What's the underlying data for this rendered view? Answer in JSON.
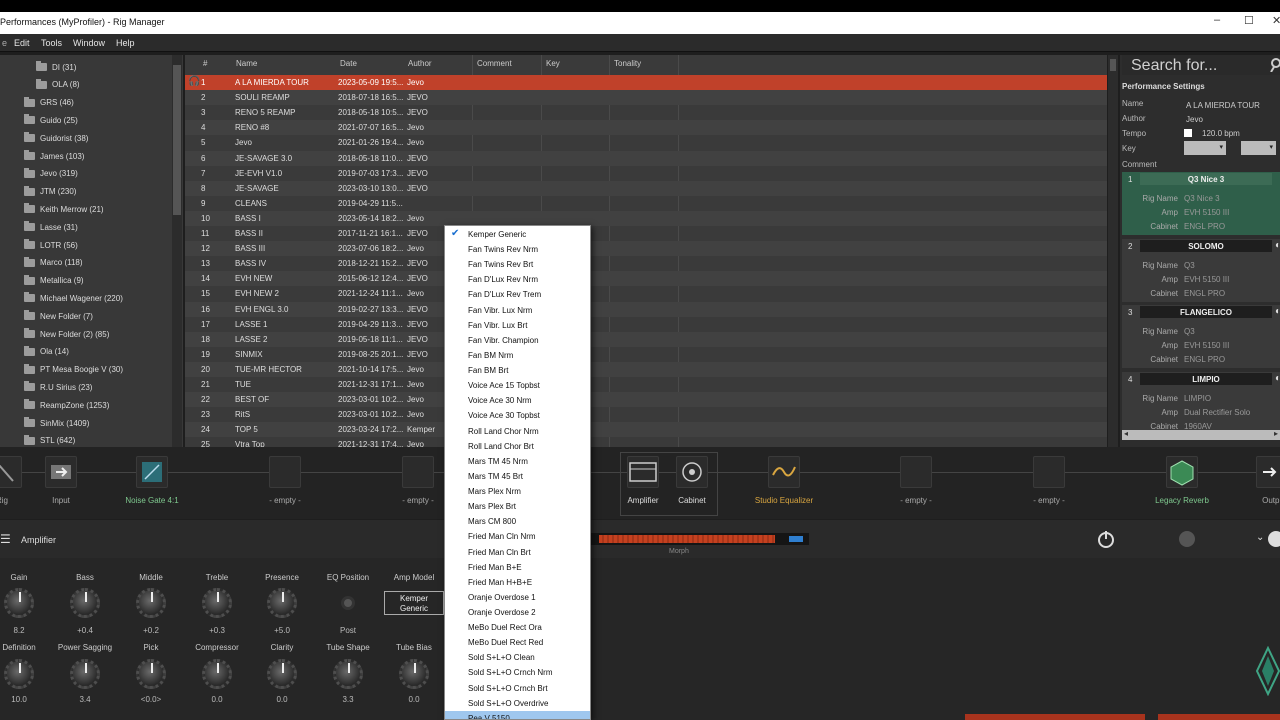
{
  "window": {
    "title": "Performances (MyProfiler) - Rig Manager",
    "minimize": "–",
    "maximize": "☐",
    "close": "✕"
  },
  "menu": [
    "Edit",
    "Tools",
    "Window",
    "Help"
  ],
  "tree": [
    "DI (31)",
    "OLA (8)",
    "GRS (46)",
    "Guido (25)",
    "Guidorist (38)",
    "James (103)",
    "Jevo (319)",
    "JTM (230)",
    "Keith Merrow (21)",
    "Lasse (31)",
    "LOTR (56)",
    "Marco (118)",
    "Metallica (9)",
    "Michael Wagener (220)",
    "New Folder (7)",
    "New Folder (2) (85)",
    "Ola (14)",
    "PT Mesa Boogie V (30)",
    "R.U Sirius (23)",
    "ReampZone (1253)",
    "SinMix (1409)",
    "STL (642)"
  ],
  "table": {
    "headers": [
      "#",
      "Name",
      "Date",
      "Author",
      "Comment",
      "Key",
      "Tonality"
    ],
    "rows": [
      [
        "1",
        "A LA MIERDA TOUR",
        "2023-05-09 19:5...",
        "Jevo"
      ],
      [
        "2",
        "SOULI REAMP",
        "2018-07-18 16:5...",
        "JEVO"
      ],
      [
        "3",
        "RENO 5 REAMP",
        "2018-05-18 10:5...",
        "JEVO"
      ],
      [
        "4",
        "RENO #8",
        "2021-07-07 16:5...",
        "Jevo"
      ],
      [
        "5",
        "Jevo",
        "2021-01-26 19:4...",
        "Jevo"
      ],
      [
        "6",
        "JE-SAVAGE 3.0",
        "2018-05-18 11:0...",
        "JEVO"
      ],
      [
        "7",
        "JE-EVH V1.0",
        "2019-07-03 17:3...",
        "JEVO"
      ],
      [
        "8",
        "JE-SAVAGE",
        "2023-03-10 13:0...",
        "JEVO"
      ],
      [
        "9",
        "CLEANS",
        "2019-04-29 11:5...",
        ""
      ],
      [
        "10",
        "BASS I",
        "2023-05-14 18:2...",
        "Jevo"
      ],
      [
        "11",
        "BASS II",
        "2017-11-21 16:1...",
        "JEVO"
      ],
      [
        "12",
        "BASS III",
        "2023-07-06 18:2...",
        "Jevo"
      ],
      [
        "13",
        "BASS IV",
        "2018-12-21 15:2...",
        "JEVO"
      ],
      [
        "14",
        "EVH NEW",
        "2015-06-12 12:4...",
        "JEVO"
      ],
      [
        "15",
        "EVH NEW 2",
        "2021-12-24 11:1...",
        "Jevo"
      ],
      [
        "16",
        "EVH ENGL 3.0",
        "2019-02-27 13:3...",
        "JEVO"
      ],
      [
        "17",
        "LASSE 1",
        "2019-04-29 11:3...",
        "JEVO"
      ],
      [
        "18",
        "LASSE 2",
        "2019-05-18 11:1...",
        "JEVO"
      ],
      [
        "19",
        "SINMIX",
        "2019-08-25 20:1...",
        "JEVO"
      ],
      [
        "20",
        "TUE-MR HECTOR",
        "2021-10-14 17:5...",
        "Jevo"
      ],
      [
        "21",
        "TUE",
        "2021-12-31 17:1...",
        "Jevo"
      ],
      [
        "22",
        "BEST OF",
        "2023-03-01 10:2...",
        "Jevo"
      ],
      [
        "23",
        "RitS",
        "2023-03-01 10:2...",
        "Jevo"
      ],
      [
        "24",
        "TOP 5",
        "2023-03-24 17:2...",
        "Kemper"
      ],
      [
        "25",
        "Vtra Top",
        "2021-12-31 17:4...",
        "Jevo"
      ]
    ]
  },
  "search": {
    "placeholder": "Search for..."
  },
  "perf_settings": {
    "title": "Performance Settings",
    "name_label": "Name",
    "name": "A LA MIERDA TOUR",
    "author_label": "Author",
    "author": "Jevo",
    "tempo_label": "Tempo",
    "tempo": "120.0 bpm",
    "key_label": "Key",
    "comment_label": "Comment"
  },
  "slots": [
    {
      "num": "1",
      "name": "Q3 Nice 3",
      "rig_name": "Q3 Nice 3",
      "amp": "EVH 5150 III",
      "cabinet": "ENGL PRO"
    },
    {
      "num": "2",
      "name": "SOLOMO",
      "rig_name": "Q3",
      "amp": "EVH 5150 III",
      "cabinet": "ENGL PRO"
    },
    {
      "num": "3",
      "name": "FLANGELICO",
      "rig_name": "Q3",
      "amp": "EVH 5150 III",
      "cabinet": "ENGL PRO"
    },
    {
      "num": "4",
      "name": "LIMPIO",
      "rig_name": "LIMPIO",
      "amp": "Dual Rectifier Solo",
      "cabinet": "1960AV"
    }
  ],
  "slot_labels": {
    "rig_name": "Rig Name",
    "amp": "Amp",
    "cabinet": "Cabinet"
  },
  "chain": {
    "rig": "Rig",
    "input": "Input",
    "noise_gate": "Noise Gate 4:1",
    "empty": "- empty -",
    "amplifier": "Amplifier",
    "cabinet": "Cabinet",
    "studio_eq": "Studio Equalizer",
    "legacy_reverb": "Legacy Reverb",
    "output": "Outpu"
  },
  "amp": {
    "title": "Amplifier",
    "morph_label": "Morph",
    "row1": [
      {
        "label": "Gain",
        "value": "8.2"
      },
      {
        "label": "Bass",
        "value": "+0.4"
      },
      {
        "label": "Middle",
        "value": "+0.2"
      },
      {
        "label": "Treble",
        "value": "+0.3"
      },
      {
        "label": "Presence",
        "value": "+5.0"
      }
    ],
    "eq_position": {
      "label": "EQ Position",
      "value": "Post"
    },
    "amp_model": {
      "label": "Amp Model",
      "value_line1": "Kemper",
      "value_line2": "Generic"
    },
    "row2": [
      {
        "label": "Definition",
        "value": "10.0"
      },
      {
        "label": "Power Sagging",
        "value": "3.4"
      },
      {
        "label": "Pick",
        "value": "<0.0>"
      },
      {
        "label": "Compressor",
        "value": "0.0"
      },
      {
        "label": "Clarity",
        "value": "0.0"
      },
      {
        "label": "Tube Shape",
        "value": "3.3"
      },
      {
        "label": "Tube Bias",
        "value": "0.0"
      }
    ]
  },
  "dropdown": {
    "checkmark": "✔",
    "items": [
      "Kemper Generic",
      "Fan Twins Rev Nrm",
      "Fan Twins Rev Brt",
      "Fan D'Lux Rev Nrm",
      "Fan D'Lux Rev Trem",
      "Fan Vibr. Lux Nrm",
      "Fan Vibr. Lux Brt",
      "Fan Vibr. Champion",
      "Fan BM Nrm",
      "Fan BM Brt",
      "Voice Ace 15 Topbst",
      "Voice Ace 30 Nrm",
      "Voice Ace 30 Topbst",
      "Roll Land Chor Nrm",
      "Roll Land Chor Brt",
      "Mars TM 45 Nrm",
      "Mars TM 45 Brt",
      "Mars Plex Nrm",
      "Mars Plex Brt",
      "Mars CM 800",
      "Fried Man Cln Nrm",
      "Fried Man Cln Brt",
      "Fried Man B+E",
      "Fried Man H+B+E",
      "Oranje Overdose 1",
      "Oranje Overdose 2",
      "MeBo Duel Rect Ora",
      "MeBo Duel Rect Red",
      "Sold S+L+O Clean",
      "Sold S+L+O Crnch Nrm",
      "Sold S+L+O Crnch Brt",
      "Sold S+L+O Overdrive",
      "Pea V 5150"
    ]
  },
  "colors": {
    "selected_row": "#c0412a",
    "active_slot": "#2f5f4a",
    "accent_green": "#7fc98f",
    "highlight": "#9fc7ee"
  }
}
